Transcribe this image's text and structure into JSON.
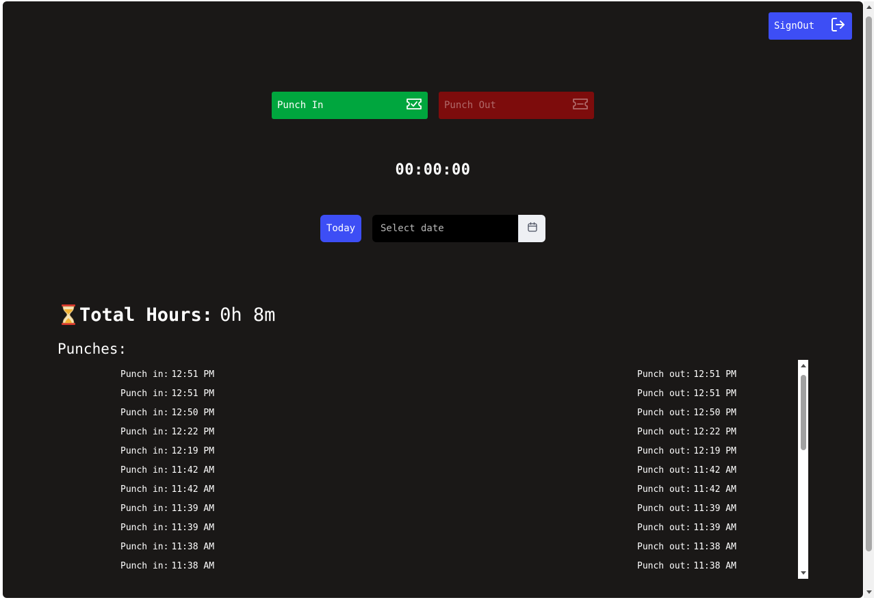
{
  "header": {
    "signout_label": "SignOut",
    "signout_icon": "logout-icon"
  },
  "actions": {
    "punch_in_label": "Punch In",
    "punch_in_icon": "ticket-check-icon",
    "punch_out_label": "Punch Out",
    "punch_out_icon": "ticket-icon"
  },
  "timer": "00:00:00",
  "date_filter": {
    "today_label": "Today",
    "placeholder": "Select date",
    "calendar_icon": "calendar-icon"
  },
  "summary": {
    "icon": "hourglass-icon",
    "label": "Total Hours:",
    "value": "0h 8m"
  },
  "punches": {
    "title": "Punches:",
    "in_label": "Punch in:",
    "out_label": "Punch out:",
    "rows": [
      {
        "in": "12:51 PM",
        "out": "12:51 PM"
      },
      {
        "in": "12:51 PM",
        "out": "12:51 PM"
      },
      {
        "in": "12:50 PM",
        "out": "12:50 PM"
      },
      {
        "in": "12:22 PM",
        "out": "12:22 PM"
      },
      {
        "in": "12:19 PM",
        "out": "12:19 PM"
      },
      {
        "in": "11:42 AM",
        "out": "11:42 AM"
      },
      {
        "in": "11:42 AM",
        "out": "11:42 AM"
      },
      {
        "in": "11:39 AM",
        "out": "11:39 AM"
      },
      {
        "in": "11:39 AM",
        "out": "11:39 AM"
      },
      {
        "in": "11:38 AM",
        "out": "11:38 AM"
      },
      {
        "in": "11:38 AM",
        "out": "11:38 AM"
      }
    ]
  },
  "colors": {
    "background": "#1a1817",
    "primary": "#3d4ef5",
    "punch_in": "#00a63e",
    "punch_out": "#7d0c0c"
  }
}
